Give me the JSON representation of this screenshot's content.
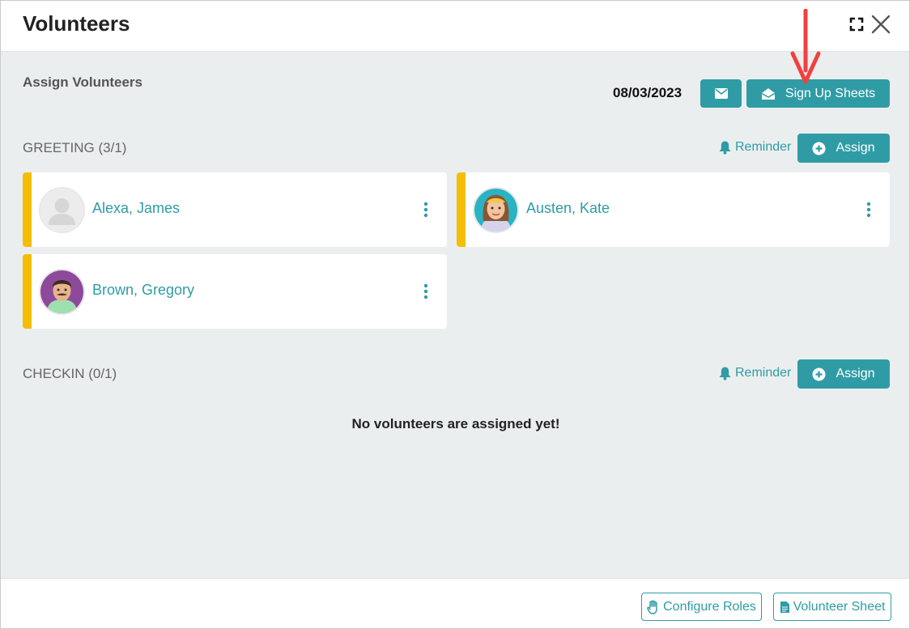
{
  "header": {
    "title": "Volunteers"
  },
  "toolbar": {
    "heading": "Assign Volunteers",
    "date": "08/03/2023",
    "signup_label": "Sign Up Sheets"
  },
  "sections": [
    {
      "title": "GREETING (3/1)",
      "reminder_label": "Reminder",
      "assign_label": "Assign",
      "volunteers": [
        {
          "name": "Alexa, James"
        },
        {
          "name": "Austen, Kate"
        },
        {
          "name": "Brown, Gregory"
        }
      ]
    },
    {
      "title": "CHECKIN (0/1)",
      "reminder_label": "Reminder",
      "assign_label": "Assign",
      "empty_message": "No volunteers are assigned yet!"
    }
  ],
  "footer": {
    "configure_roles_label": "Configure Roles",
    "volunteer_sheet_label": "Volunteer Sheet"
  },
  "colors": {
    "accent": "#2f9ca5",
    "card_stripe": "#f5bd05",
    "annotation_arrow": "#f04040"
  }
}
